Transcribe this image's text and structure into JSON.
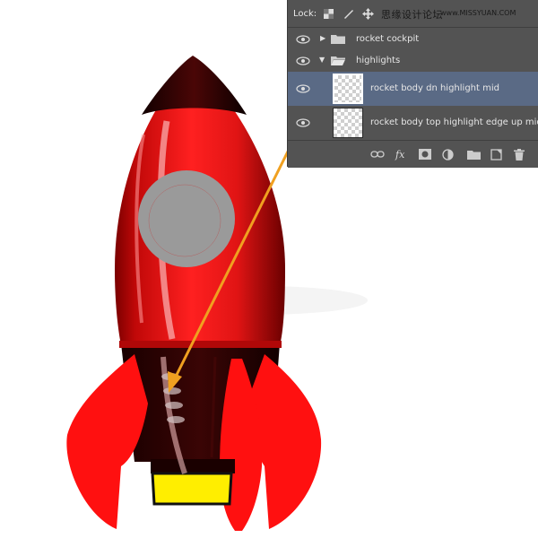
{
  "panel": {
    "lock_label": "Lock:",
    "watermark_text": "思缘设计论坛",
    "watermark_url": "www.MISSYUAN.COM",
    "layers": [
      {
        "name": "rocket cockpit",
        "type": "group",
        "expanded": false
      },
      {
        "name": "highlights",
        "type": "group",
        "expanded": true
      },
      {
        "name": "rocket body dn highlight mid",
        "type": "layer",
        "selected": true
      },
      {
        "name": "rocket body top highlight edge up mid",
        "type": "layer",
        "selected": false
      }
    ],
    "bottom_icons": [
      "link-icon",
      "fx-icon",
      "mask-icon",
      "adjustment-icon",
      "folder-icon",
      "new-layer-icon",
      "trash-icon"
    ],
    "fx_label": "fx"
  },
  "colors": {
    "rocket_red": "#e31010",
    "rocket_dark": "#1a0000",
    "window_gray": "#9a9a9a",
    "flame_yellow": "#ffee00",
    "arrow_orange": "#f0a020",
    "panel_bg": "#535353",
    "panel_selected": "#5a6a85"
  }
}
